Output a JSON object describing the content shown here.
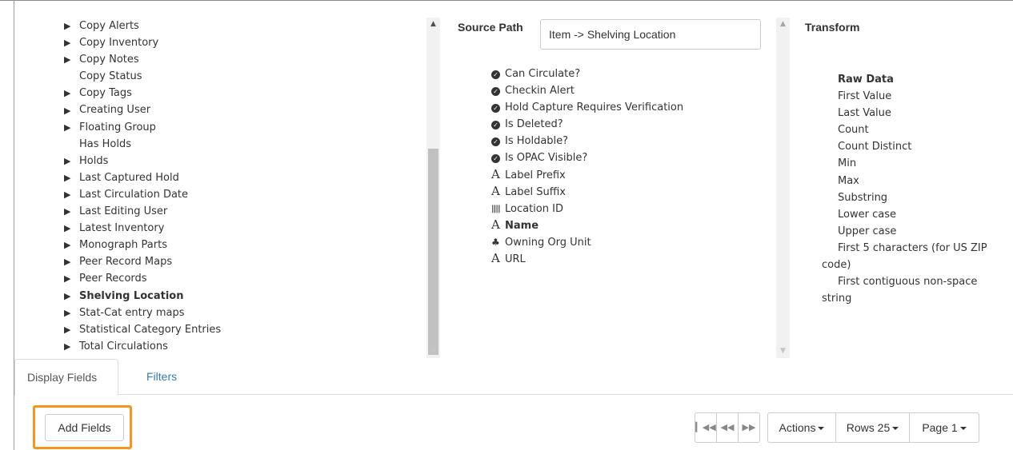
{
  "tree": {
    "items": [
      {
        "label": "Copy Alerts",
        "expandable": true,
        "bold": false
      },
      {
        "label": "Copy Inventory",
        "expandable": true,
        "bold": false
      },
      {
        "label": "Copy Notes",
        "expandable": true,
        "bold": false
      },
      {
        "label": "Copy Status",
        "expandable": false,
        "bold": false
      },
      {
        "label": "Copy Tags",
        "expandable": true,
        "bold": false
      },
      {
        "label": "Creating User",
        "expandable": true,
        "bold": false
      },
      {
        "label": "Floating Group",
        "expandable": true,
        "bold": false
      },
      {
        "label": "Has Holds",
        "expandable": false,
        "bold": false
      },
      {
        "label": "Holds",
        "expandable": true,
        "bold": false
      },
      {
        "label": "Last Captured Hold",
        "expandable": true,
        "bold": false
      },
      {
        "label": "Last Circulation Date",
        "expandable": true,
        "bold": false
      },
      {
        "label": "Last Editing User",
        "expandable": true,
        "bold": false
      },
      {
        "label": "Latest Inventory",
        "expandable": true,
        "bold": false
      },
      {
        "label": "Monograph Parts",
        "expandable": true,
        "bold": false
      },
      {
        "label": "Peer Record Maps",
        "expandable": true,
        "bold": false
      },
      {
        "label": "Peer Records",
        "expandable": true,
        "bold": false
      },
      {
        "label": "Shelving Location",
        "expandable": true,
        "bold": true
      },
      {
        "label": "Stat-Cat entry maps",
        "expandable": true,
        "bold": false
      },
      {
        "label": "Statistical Category Entries",
        "expandable": true,
        "bold": false
      },
      {
        "label": "Total Circulations",
        "expandable": true,
        "bold": false
      }
    ]
  },
  "source_path": {
    "label": "Source Path",
    "value": "Item -> Shelving Location"
  },
  "fields": [
    {
      "icon": "check-circle-icon",
      "glyph": "✓",
      "label": "Can Circulate?",
      "bold": false
    },
    {
      "icon": "check-circle-icon",
      "glyph": "✓",
      "label": "Checkin Alert",
      "bold": false
    },
    {
      "icon": "check-circle-icon",
      "glyph": "✓",
      "label": "Hold Capture Requires Verification",
      "bold": false
    },
    {
      "icon": "check-circle-icon",
      "glyph": "✓",
      "label": "Is Deleted?",
      "bold": false
    },
    {
      "icon": "check-circle-icon",
      "glyph": "✓",
      "label": "Is Holdable?",
      "bold": false
    },
    {
      "icon": "check-circle-icon",
      "glyph": "✓",
      "label": "Is OPAC Visible?",
      "bold": false
    },
    {
      "icon": "text-icon",
      "glyph": "A",
      "label": "Label Prefix",
      "bold": false
    },
    {
      "icon": "text-icon",
      "glyph": "A",
      "label": "Label Suffix",
      "bold": false
    },
    {
      "icon": "barcode-icon",
      "glyph": "||||",
      "label": "Location ID",
      "bold": false
    },
    {
      "icon": "text-icon",
      "glyph": "A",
      "label": "Name",
      "bold": true
    },
    {
      "icon": "tree-icon",
      "glyph": "♣",
      "label": "Owning Org Unit",
      "bold": false
    },
    {
      "icon": "text-icon",
      "glyph": "A",
      "label": "URL",
      "bold": false
    }
  ],
  "transform": {
    "label": "Transform",
    "options": [
      {
        "label": "Raw Data",
        "selected": true
      },
      {
        "label": "First Value",
        "selected": false
      },
      {
        "label": "Last Value",
        "selected": false
      },
      {
        "label": "Count",
        "selected": false
      },
      {
        "label": "Count Distinct",
        "selected": false
      },
      {
        "label": "Min",
        "selected": false
      },
      {
        "label": "Max",
        "selected": false
      },
      {
        "label": "Substring",
        "selected": false
      },
      {
        "label": "Lower case",
        "selected": false
      },
      {
        "label": "Upper case",
        "selected": false
      },
      {
        "label": "First 5 characters (for US ZIP code)",
        "selected": false
      },
      {
        "label": "First contiguous non-space string",
        "selected": false
      }
    ]
  },
  "tabs": {
    "display_fields": "Display Fields",
    "filters": "Filters"
  },
  "actions": {
    "add_fields": "Add Fields"
  },
  "pager": {
    "first_icon": "first-page-icon",
    "prev_icon": "prev-page-icon",
    "next_icon": "next-page-icon",
    "actions_label": "Actions",
    "rows_label": "Rows 25",
    "page_label": "Page 1"
  }
}
